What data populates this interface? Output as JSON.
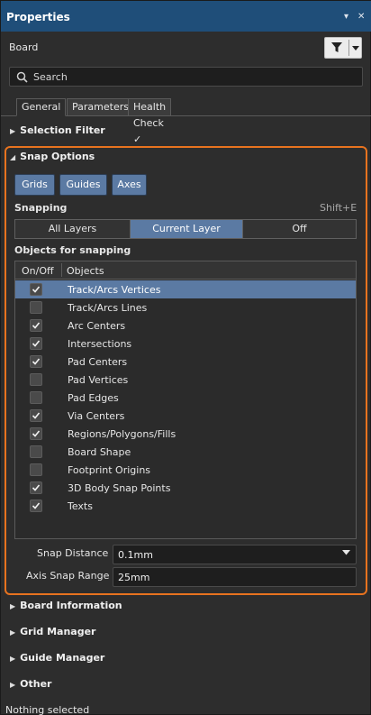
{
  "panel": {
    "title": "Properties",
    "pin_glyph": "▾",
    "close_glyph": "✕"
  },
  "board": {
    "label": "Board",
    "filter_icon": "filter-icon"
  },
  "search": {
    "placeholder": "Search"
  },
  "tabs": [
    {
      "label": "General",
      "active": true
    },
    {
      "label": "Parameters",
      "active": false
    },
    {
      "label": "Health Check ✓",
      "active": false
    }
  ],
  "sections": {
    "selection_filter": "Selection Filter",
    "snap_options": "Snap Options",
    "board_information": "Board Information",
    "grid_manager": "Grid Manager",
    "guide_manager": "Guide Manager",
    "other": "Other"
  },
  "snap": {
    "buttons": [
      "Grids",
      "Guides",
      "Axes"
    ],
    "snapping_label": "Snapping",
    "snapping_shortcut": "Shift+E",
    "layer_options": [
      {
        "label": "All Layers",
        "selected": false
      },
      {
        "label": "Current Layer",
        "selected": true
      },
      {
        "label": "Off",
        "selected": false
      }
    ],
    "objects_label": "Objects for snapping",
    "table_headers": {
      "onoff": "On/Off",
      "objects": "Objects"
    },
    "objects": [
      {
        "label": "Track/Arcs Vertices",
        "checked": true,
        "selected": true
      },
      {
        "label": "Track/Arcs Lines",
        "checked": false,
        "selected": false
      },
      {
        "label": "Arc Centers",
        "checked": true,
        "selected": false
      },
      {
        "label": "Intersections",
        "checked": true,
        "selected": false
      },
      {
        "label": "Pad Centers",
        "checked": true,
        "selected": false
      },
      {
        "label": "Pad Vertices",
        "checked": false,
        "selected": false
      },
      {
        "label": "Pad Edges",
        "checked": false,
        "selected": false
      },
      {
        "label": "Via Centers",
        "checked": true,
        "selected": false
      },
      {
        "label": "Regions/Polygons/Fills",
        "checked": true,
        "selected": false
      },
      {
        "label": "Board Shape",
        "checked": false,
        "selected": false
      },
      {
        "label": "Footprint Origins",
        "checked": false,
        "selected": false
      },
      {
        "label": "3D Body Snap Points",
        "checked": true,
        "selected": false
      },
      {
        "label": "Texts",
        "checked": true,
        "selected": false
      }
    ],
    "snap_distance_label": "Snap Distance",
    "snap_distance_value": "0.1mm",
    "axis_snap_label": "Axis Snap Range",
    "axis_snap_value": "25mm"
  },
  "status": "Nothing selected",
  "colors": {
    "accent_blue": "#5b7aa3",
    "highlight_orange": "#e8731f",
    "titlebar": "#1f4e79",
    "background": "#2d2d2d"
  }
}
